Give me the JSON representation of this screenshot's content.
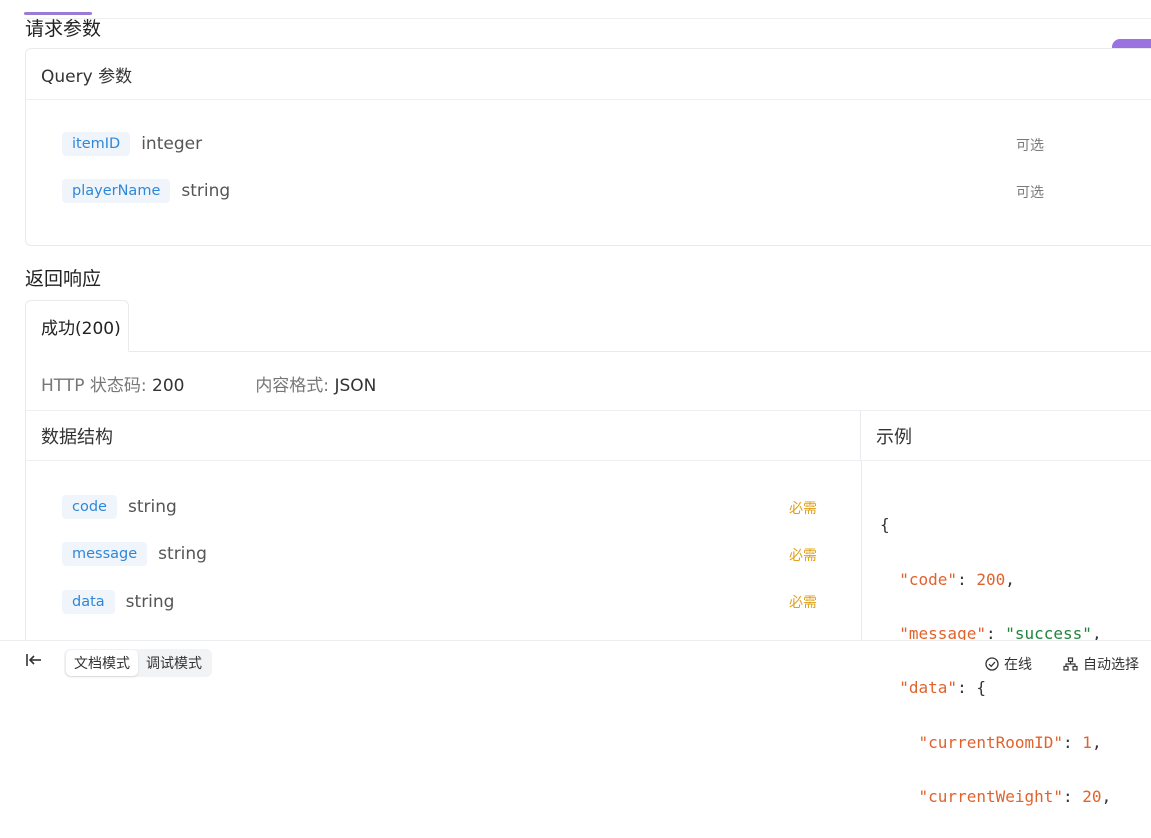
{
  "request": {
    "section_title": "请求参数",
    "query_header": "Query 参数",
    "params": [
      {
        "name": "itemID",
        "type": "integer",
        "flag": "可选"
      },
      {
        "name": "playerName",
        "type": "string",
        "flag": "可选"
      }
    ]
  },
  "response": {
    "section_title": "返回响应",
    "tab_label": "成功(200)",
    "status_label": "HTTP 状态码:",
    "status_value": "200",
    "format_label": "内容格式:",
    "format_value": "JSON",
    "structure_header": "数据结构",
    "example_header": "示例",
    "fields": [
      {
        "name": "code",
        "type": "string",
        "flag": "必需"
      },
      {
        "name": "message",
        "type": "string",
        "flag": "必需"
      },
      {
        "name": "data",
        "type": "string",
        "flag": "必需"
      }
    ],
    "example_lines": [
      {
        "indent": "",
        "key": "",
        "value": "",
        "vtype": "",
        "punct": "{"
      },
      {
        "indent": "  ",
        "key": "\"code\"",
        "value": "200",
        "vtype": "n",
        "punct": ","
      },
      {
        "indent": "  ",
        "key": "\"message\"",
        "value": "\"success\"",
        "vtype": "s",
        "punct": ","
      },
      {
        "indent": "  ",
        "key": "\"data\"",
        "value": "",
        "vtype": "",
        "punct": "{"
      },
      {
        "indent": "    ",
        "key": "\"currentRoomID\"",
        "value": "1",
        "vtype": "n",
        "punct": ","
      },
      {
        "indent": "    ",
        "key": "\"currentWeight\"",
        "value": "20",
        "vtype": "n",
        "punct": ","
      }
    ]
  },
  "footer": {
    "mode_doc": "文档模式",
    "mode_debug": "调试模式",
    "online": "在线",
    "auto_select": "自动选择"
  },
  "colors": {
    "accent_purple": "#9b73e0",
    "param_blue": "#2f87d8",
    "required_orange": "#e0a016",
    "json_key": "#e0632d",
    "json_string": "#21843e"
  }
}
